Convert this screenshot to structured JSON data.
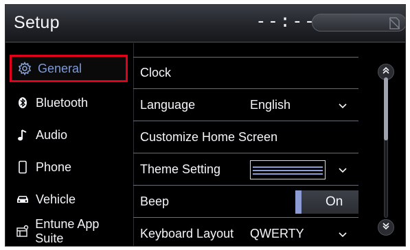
{
  "header": {
    "title": "Setup",
    "clock": "--:--"
  },
  "sidebar": {
    "items": [
      {
        "label": "General",
        "icon": "gear-icon",
        "active": true
      },
      {
        "label": "Bluetooth",
        "icon": "bluetooth-icon",
        "active": false
      },
      {
        "label": "Audio",
        "icon": "music-note-icon",
        "active": false
      },
      {
        "label": "Phone",
        "icon": "phone-icon",
        "active": false
      },
      {
        "label": "Vehicle",
        "icon": "car-icon",
        "active": false
      },
      {
        "label": "Entune App Suite",
        "icon": "app-suite-icon",
        "active": false
      }
    ]
  },
  "settings": {
    "clock": {
      "label": "Clock"
    },
    "language": {
      "label": "Language",
      "value": "English"
    },
    "home_screen": {
      "label": "Customize Home Screen"
    },
    "theme": {
      "label": "Theme Setting"
    },
    "beep": {
      "label": "Beep",
      "value": "On"
    },
    "keyboard": {
      "label": "Keyboard Layout",
      "value": "QWERTY"
    }
  },
  "colors": {
    "selection_highlight": "#e3001b",
    "active_text": "#7f9bd6",
    "accent": "#8c9bd4"
  }
}
